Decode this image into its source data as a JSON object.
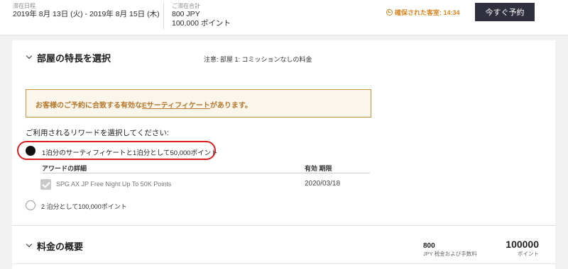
{
  "header": {
    "stay_caption": "滞在日程",
    "stay_value": "2019年 8月 13日 (火) - 2019年 8月 15日 (木)",
    "total_caption": "ご滞在合計",
    "total_jpy": "800 JPY",
    "total_points": "100,000 ポイント",
    "timer_label": "確保された客室: 14:34",
    "book_button": "今すぐ予約"
  },
  "room_features": {
    "title": "部屋の特長を選択",
    "note": "注意: 部屋 1: コミッションなしの料金",
    "cert_notice_prefix": "お客様のご予約に合致する有効な",
    "cert_notice_link": "Eサーティフィケート",
    "cert_notice_suffix": "があります。",
    "reward_question": "ご利用されるリワードを選択してください:",
    "option1": "1泊分のサーティフィケートと1泊分として50,000ポイント",
    "award_header": "アワードの詳細",
    "expiry_header": "有効 期限",
    "cert_name": "SPG AX JP Free Night Up To 50K Points",
    "cert_expiry": "2020/03/18",
    "option2": "2 泊分として100,000ポイント"
  },
  "rate_summary": {
    "title": "料金の概要",
    "price_value": "800",
    "price_label": "JPY 税金および手数料",
    "points_value": "100000",
    "points_label": "ポイント"
  },
  "colors": {
    "accent_orange": "#d8831b",
    "button_dark": "#2f2f3d",
    "highlight_red": "#d81f1f",
    "notice_border": "#c8913e"
  },
  "icons": {
    "timer": "clock-icon",
    "section_toggle": "chevron-down-icon",
    "checkbox": "checkmark-icon"
  }
}
